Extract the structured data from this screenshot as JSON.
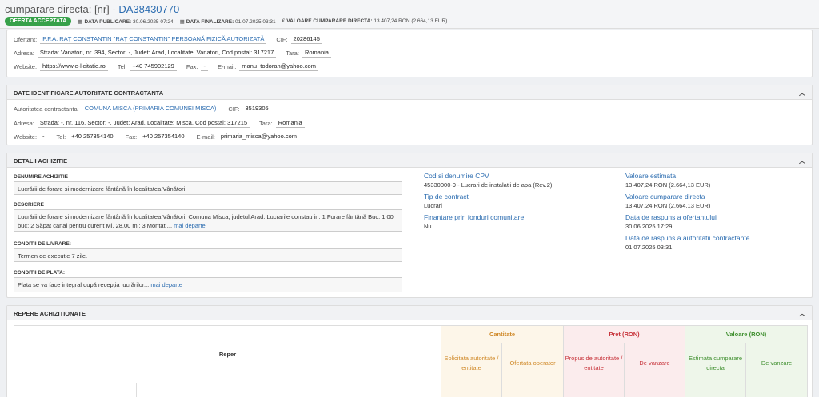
{
  "header": {
    "title_prefix": "cumparare directa: [nr] - ",
    "code": "DA38430770",
    "badge": "OFERTA ACCEPTATA",
    "publish_label": "DATA PUBLICARE:",
    "publish_value": "30.06.2025 07:24",
    "finalize_label": "DATA FINALIZARE:",
    "finalize_value": "01.07.2025 03:31",
    "value_label": "VALOARE CUMPARARE DIRECTA:",
    "value_value": "13.407,24  RON (2.664,13  EUR)"
  },
  "ofertant": {
    "label": "Ofertant:",
    "name": "P.F.A. RAȚ CONSTANTIN \"RAȚ CONSTANTIN\" PERSOANĂ FIZICĂ AUTORIZATĂ",
    "cif_label": "CIF:",
    "cif": "20286145",
    "adresa_label": "Adresa:",
    "adresa": "Strada: Vanatori, nr. 394, Sector: -, Judet: Arad, Localitate: Vanatori, Cod postal: 317217",
    "tara_label": "Tara:",
    "tara": "Romania",
    "website_label": "Website:",
    "website": "https://www.e-licitatie.ro",
    "tel_label": "Tel:",
    "tel": "+40 745902129",
    "fax_label": "Fax:",
    "fax": "-",
    "email_label": "E-mail:",
    "email": "manu_todoran@yahoo.com"
  },
  "autoritate": {
    "section_title": "DATE IDENTIFICARE AUTORITATE CONTRACTANTA",
    "label": "Autoritatea contractanta:",
    "name": "COMUNA MISCA (PRIMARIA COMUNEI MISCA)",
    "cif_label": "CIF:",
    "cif": "3519305",
    "adresa_label": "Adresa:",
    "adresa": "Strada: -, nr. 116, Sector: -, Judet: Arad, Localitate: Misca, Cod postal: 317215",
    "tara_label": "Tara:",
    "tara": "Romania",
    "website_label": "Website:",
    "website": "-",
    "tel_label": "Tel:",
    "tel": "+40 257354140",
    "fax_label": "Fax:",
    "fax": "+40 257354140",
    "email_label": "E-mail:",
    "email": "primaria_misca@yahoo.com"
  },
  "detalii": {
    "section_title": "DETALII ACHIZITIE",
    "denumire_label": "DENUMIRE ACHIZITIE",
    "denumire": "Lucrării de forare și modernizare fântână în localitatea Vânători",
    "descriere_label": "DESCRIERE",
    "descriere": "Lucrării de forare și modernizare fântână în localitatea Vânători, Comuna Misca, judetul Arad. Lucrarile constau in: 1 Forare fântână Buc. 1,00 buc; 2 Săpat canal pentru curent Ml. 28,00 ml; 3 Montat ...",
    "mai_departe": "mai departe",
    "livrare_label": "CONDITII DE LIVRARE:",
    "livrare": "Termen de executie 7 zile.",
    "plata_label": "CONDITII DE PLATA:",
    "plata": "Plata se va face integral după recepția lucrărilor...",
    "cpv_label": "Cod si denumire CPV",
    "cpv": "45330000-9 - Lucrari de instalatii de apa (Rev.2)",
    "tip_label": "Tip de contract",
    "tip": "Lucrari",
    "fonduri_label": "Finantare prin fonduri comunitare",
    "fonduri": "Nu",
    "estimata_label": "Valoare estimata",
    "estimata": "13.407,24  RON (2.664,13  EUR)",
    "cumparare_label": "Valoare cumparare directa",
    "cumparare": "13.407,24  RON (2.664,13  EUR)",
    "raspuns_of_label": "Data de raspuns a ofertantului",
    "raspuns_of": "30.06.2025 17:29",
    "raspuns_ac_label": "Data de raspuns a autoritatii contractante",
    "raspuns_ac": "01.07.2025 03:31"
  },
  "repere": {
    "section_title": "REPERE ACHIZITIONATE",
    "col_reper": "Reper",
    "grp_cantitate": "Cantitate",
    "grp_pret": "Pret (RON)",
    "grp_valoare": "Valoare (RON)",
    "c_solicitata": "Solicitata autoritate / entitate",
    "c_ofertata": "Ofertata operator",
    "c_propus": "Propus de autoritate / entitate",
    "c_devanzare_p": "De vanzare",
    "c_estimata": "Estimata cumparare directa",
    "c_devanzare_v": "De vanzare"
  },
  "colors": {
    "accent": "#2b6cb0",
    "badge": "#37a14a",
    "cantitate": "#d08a2a",
    "pret": "#c7333a",
    "valoare": "#3f8f2f"
  }
}
